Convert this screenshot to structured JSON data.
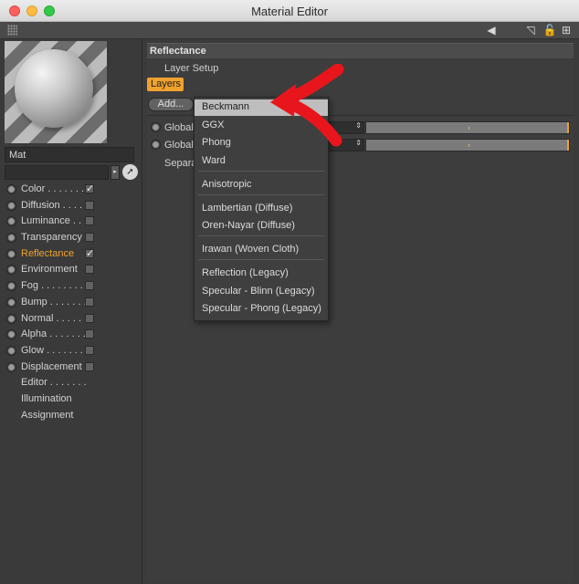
{
  "window": {
    "title": "Material Editor"
  },
  "material": {
    "name": "Mat"
  },
  "channels": [
    {
      "label": "Color . . . . . . .",
      "checked": true,
      "radio": true,
      "active": false
    },
    {
      "label": "Diffusion . . . .",
      "checked": false,
      "radio": true,
      "active": false
    },
    {
      "label": "Luminance . . .",
      "checked": false,
      "radio": true,
      "active": false
    },
    {
      "label": "Transparency",
      "checked": false,
      "radio": true,
      "active": false
    },
    {
      "label": "Reflectance",
      "checked": true,
      "radio": true,
      "active": true
    },
    {
      "label": "Environment",
      "checked": false,
      "radio": true,
      "active": false
    },
    {
      "label": "Fog . . . . . . . .",
      "checked": false,
      "radio": true,
      "active": false
    },
    {
      "label": "Bump . . . . . . .",
      "checked": false,
      "radio": true,
      "active": false
    },
    {
      "label": "Normal . . . . . .",
      "checked": false,
      "radio": true,
      "active": false
    },
    {
      "label": "Alpha . . . . . . .",
      "checked": false,
      "radio": true,
      "active": false
    },
    {
      "label": "Glow . . . . . . . .",
      "checked": false,
      "radio": true,
      "active": false
    },
    {
      "label": "Displacement",
      "checked": false,
      "radio": true,
      "active": false
    },
    {
      "label": "Editor . . . . . . .",
      "checked": false,
      "radio": false,
      "active": false
    },
    {
      "label": "Illumination",
      "checked": false,
      "radio": false,
      "active": false
    },
    {
      "label": "Assignment",
      "checked": false,
      "radio": false,
      "active": false
    }
  ],
  "main": {
    "section_title": "Reflectance",
    "layer_setup": "Layer Setup",
    "layers_tab": "Layers",
    "add_button": "Add...",
    "props": [
      {
        "label": "Global"
      },
      {
        "label": "Global"
      }
    ],
    "separate_label": "Separa"
  },
  "add_menu": {
    "items": [
      {
        "label": "Beckmann",
        "highlighted": true
      },
      {
        "label": "GGX"
      },
      {
        "label": "Phong"
      },
      {
        "label": "Ward"
      },
      {
        "label": "Anisotropic"
      },
      {
        "label": "Lambertian (Diffuse)"
      },
      {
        "label": "Oren-Nayar (Diffuse)"
      },
      {
        "label": "Irawan (Woven Cloth)"
      },
      {
        "label": "Reflection (Legacy)"
      },
      {
        "label": "Specular - Blinn (Legacy)"
      },
      {
        "label": "Specular - Phong (Legacy)"
      }
    ]
  },
  "colors": {
    "accent": "#f0a22e",
    "annotation": "#e8161c"
  }
}
